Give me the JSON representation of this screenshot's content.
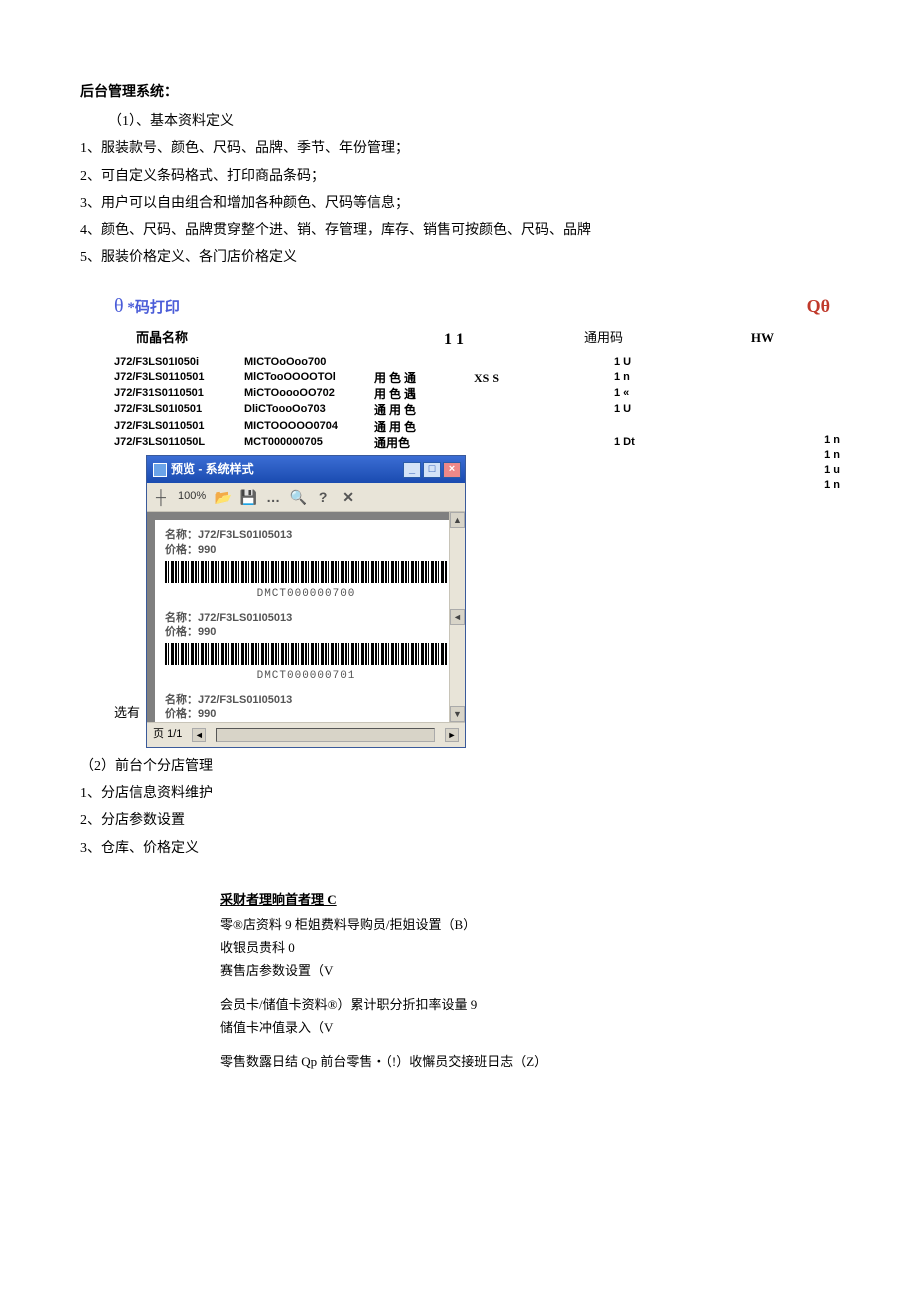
{
  "heading": "后台管理系统：",
  "intro_item": "（1）、基本资料定义",
  "bullets": [
    "1、服装款号、颜色、尺码、品牌、季节、年份管理；",
    "2、可自定义条码格式、打印商品条码；",
    "3、用户可以自由组合和增加各种颜色、尺码等信息；",
    "4、颜色、尺码、品牌贯穿整个进、销、存管理，库存、销售可按颜色、尺码、品牌",
    "5、服装价格定义、各门店价格定义"
  ],
  "print": {
    "title_prefix": "θ",
    "title": " *码打印",
    "qtheta": "Qθ",
    "sub": {
      "name": "而晶名称",
      "eleven": "1 1",
      "tym": "通用码",
      "hw": "HW"
    },
    "rows": [
      {
        "c1": "J72/F3LS01I050i",
        "c2": "MICTOoOoo700",
        "c3": "",
        "c4": "",
        "c5": "1 U"
      },
      {
        "c1": "J72/F3LS0110501",
        "c2": "MlCTooOOOOTOl",
        "c3": "用 色  通",
        "c4": "XS S",
        "c5": "1 n"
      },
      {
        "c1": "J72/F31S0110501",
        "c2": "MiCTOoooOO702",
        "c3": "用 色  遇",
        "c4": "",
        "c5": "1 «"
      },
      {
        "c1": "J72/F3LS01I0501",
        "c2": "DliCToooOo703",
        "c3": "通 用 色",
        "c4": "",
        "c5": "1 U"
      },
      {
        "c1": "J72/F3LS0110501",
        "c2": "MICTOOOOO0704",
        "c3": "通 用 色",
        "c4": "",
        "c5": ""
      },
      {
        "c1": "J72/F3LS011050L",
        "c2": "MCT000000705",
        "c3": "通用色",
        "c4": "",
        "c5": "1 Dt"
      }
    ],
    "rightnums": [
      "1 n",
      "1 n",
      "1 u",
      "1 n"
    ]
  },
  "preview": {
    "title": "预览 - 系统样式",
    "zoom_icon": "┼",
    "zoom": "100%",
    "items": [
      {
        "name": "名称：J72/F3LS01I05013",
        "price": "价格：990",
        "barcode": "DMCT000000700"
      },
      {
        "name": "名称：J72/F3LS01I05013",
        "price": "价格：990",
        "barcode": "DMCT000000701"
      },
      {
        "name": "名称：J72/F3LS01I05013",
        "price": "价格：990",
        "barcode": ""
      }
    ],
    "page_label": "页 1/1"
  },
  "selyou": "选有",
  "section2_title": "（2）前台个分店管理",
  "section2_items": [
    "1、分店信息资料维护",
    "2、分店参数设置",
    "3、仓库、价格定义"
  ],
  "menu": {
    "head": "采财者理晌首者理 C",
    "lines": [
      {
        "t": "零®店资料 9 柜姐费料导购员/拒姐设置（B）",
        "bold_end": true
      },
      {
        "t": "收银员贵科 0"
      },
      {
        "t": "赛售店参数设置（V",
        "italic_end": true
      },
      {
        "gap": true
      },
      {
        "t": "会员卡/储值卡资料®）累计职分折扣率设量 9"
      },
      {
        "t": "储值卡冲值录入（V",
        "italic_end": true
      },
      {
        "gap": true
      },
      {
        "t": "零售数露日结 Qp 前台零售・（!）收懈员交接班日志（Z）",
        "bold_mid": true
      }
    ]
  }
}
